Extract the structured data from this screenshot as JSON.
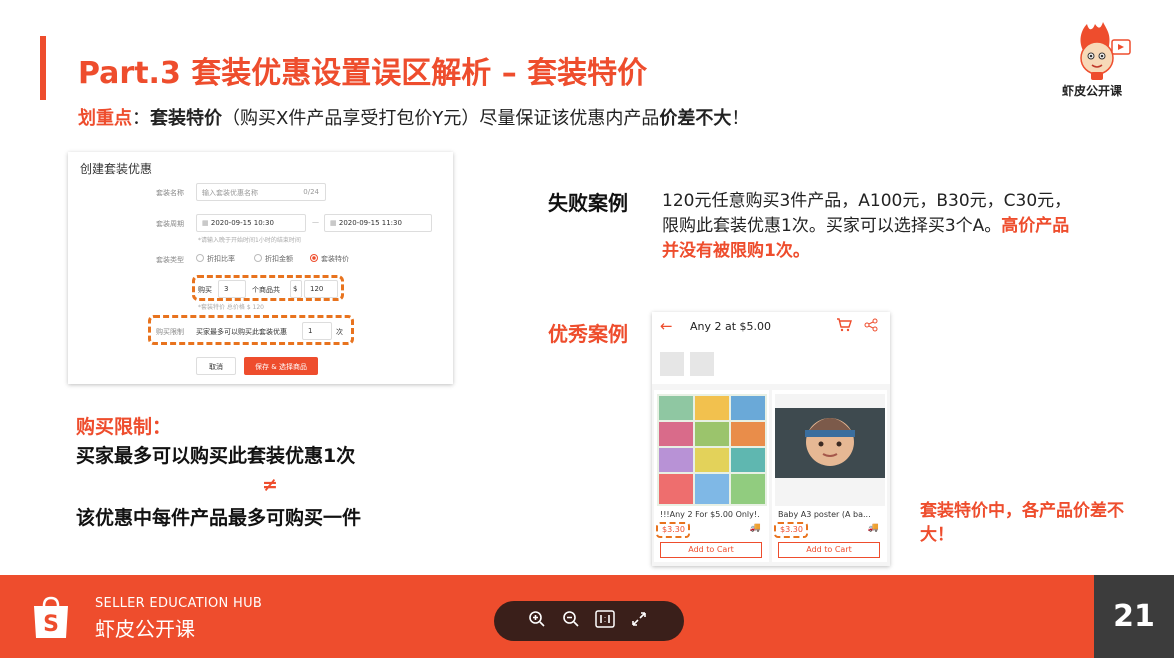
{
  "header": {
    "title": "Part.3 套装优惠设置误区解析 – 套装特价",
    "key_label": "划重点",
    "key_colon": "：",
    "key_bold": "套装特价",
    "key_paren": "（购买X件产品享受打包价Y元）尽量保证该优惠内产品",
    "key_bold2": "价差不大",
    "key_end": "！"
  },
  "logo": {
    "caption": "虾皮公开课"
  },
  "form": {
    "title": "创建套装优惠",
    "name_label": "套装名称",
    "name_placeholder": "输入套装优惠名称",
    "name_count": "0/24",
    "period_label": "套装周期",
    "start_time": "2020-09-15 10:30",
    "end_time": "2020-09-15 11:30",
    "period_hint": "*请输入晚于开始时间1小时的结束时间",
    "type_label": "套装类型",
    "type_options": [
      "折扣比率",
      "折扣金额",
      "套装特价"
    ],
    "buy_label": "购买",
    "buy_qty": "3",
    "buy_unit": "个商品共",
    "currency": "$",
    "price": "120",
    "price_hint": "*套装特价 总价格 $ 120",
    "limit_label": "购买限制",
    "limit_text": "买家最多可以购买此套装优惠",
    "limit_qty": "1",
    "limit_unit": "次",
    "cancel_btn": "取消",
    "save_btn": "保存 & 选择商品"
  },
  "left_text": {
    "limit_title": "购买限制：",
    "line1": "买家最多可以购买此套装优惠1次",
    "neq": "≠",
    "line2": "该优惠中每件产品最多可购买一件"
  },
  "fail_case": {
    "label": "失败案例",
    "text": "120元任意购买3件产品，A100元，B30元，C30元，限购此套装优惠1次。买家可以选择买3个A。",
    "highlight": "高价产品并没有被限购1次。"
  },
  "good_case": {
    "label": "优秀案例"
  },
  "phone": {
    "title": "Any 2 at $5.00",
    "products": [
      {
        "name": "!!!Any 2 For $5.00 Only!...",
        "price": "$3.30",
        "button": "Add to Cart"
      },
      {
        "name": "Baby A3 poster (A ba...",
        "price": "$3.30",
        "button": "Add to Cart"
      }
    ]
  },
  "note": {
    "text": "套装特价中，各产品价差不大！"
  },
  "footer": {
    "hub_en": "SELLER EDUCATION HUB",
    "hub_cn": "虾皮公开课",
    "page_number": "21",
    "brand_color": "#ee4d2d"
  }
}
